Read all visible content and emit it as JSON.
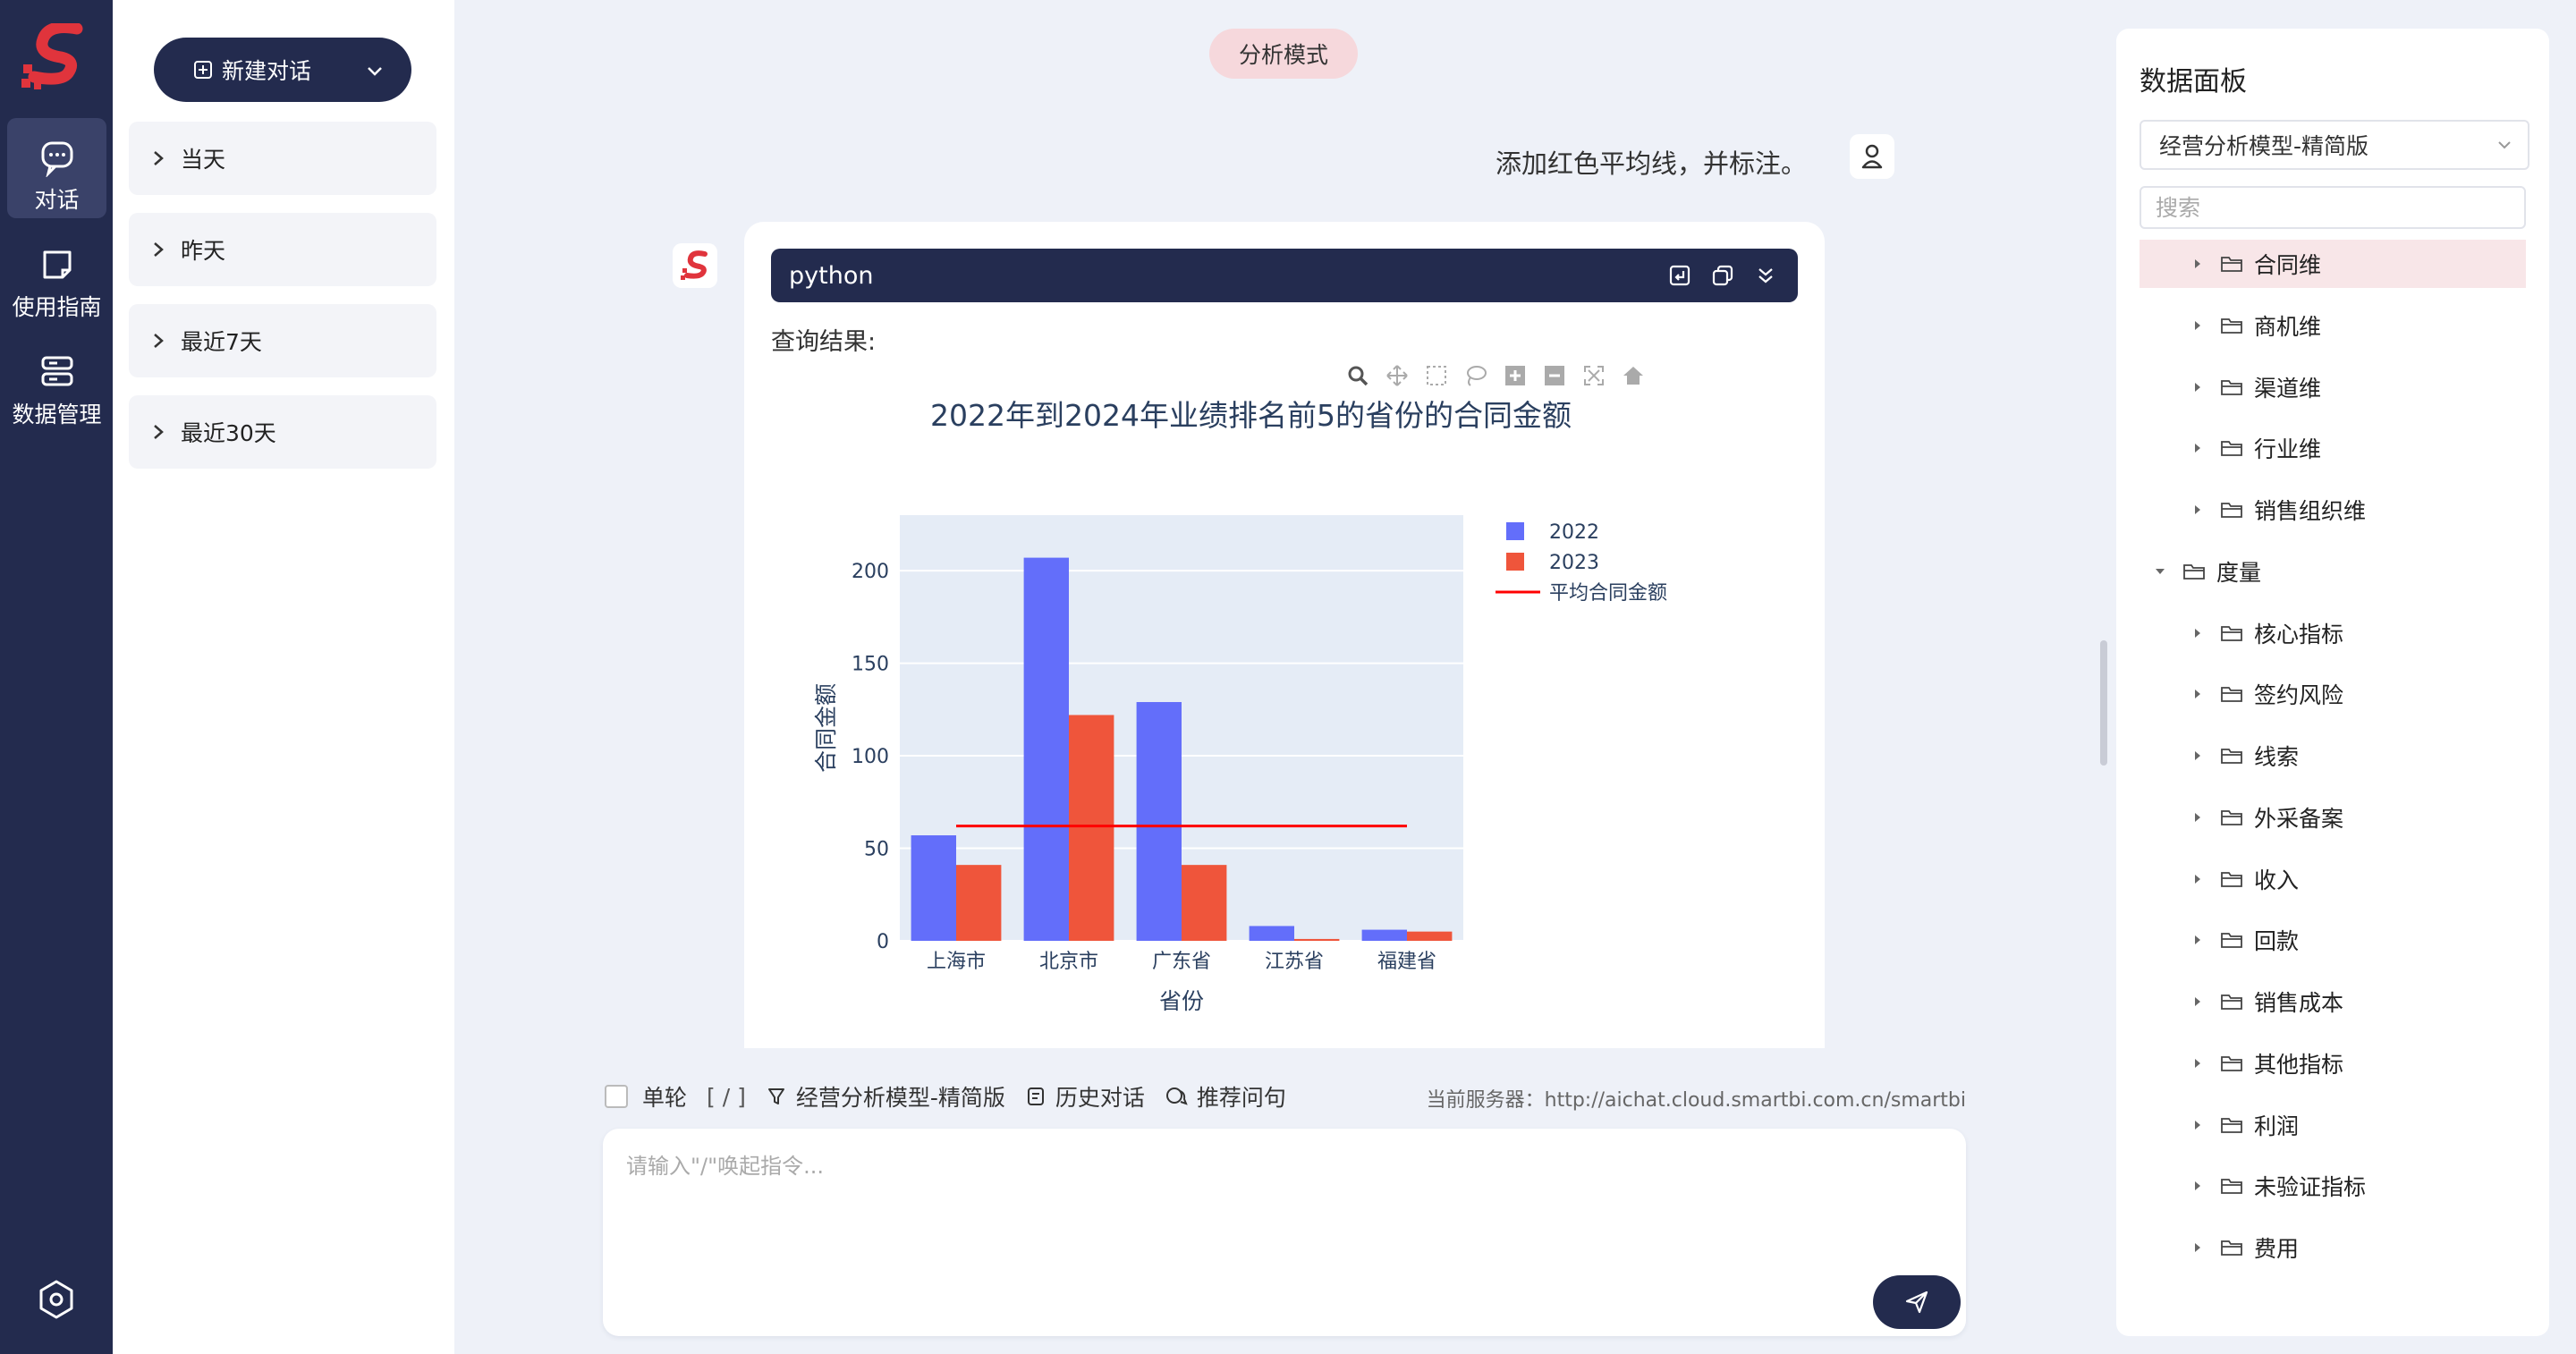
{
  "nav": {
    "items": [
      {
        "label": "对话",
        "icon": "chat-icon"
      },
      {
        "label": "使用指南",
        "icon": "guide-icon"
      },
      {
        "label": "数据管理",
        "icon": "database-icon"
      }
    ],
    "settings_icon": "settings-icon"
  },
  "history": {
    "new_chat_label": "新建对话",
    "groups": [
      "当天",
      "昨天",
      "最近7天",
      "最近30天"
    ]
  },
  "main": {
    "mode_label": "分析模式",
    "user_message": "添加红色平均线，并标注。",
    "code_language": "python",
    "result_label": "查询结果:"
  },
  "chart_data": {
    "type": "bar",
    "title": "2022年到2024年业绩排名前5的省份的合同金额",
    "xlabel": "省份",
    "ylabel": "合同金额",
    "categories": [
      "上海市",
      "北京市",
      "广东省",
      "江苏省",
      "福建省"
    ],
    "series": [
      {
        "name": "2022",
        "values": [
          57,
          207,
          129,
          8,
          6
        ],
        "color": "#636efa"
      },
      {
        "name": "2023",
        "values": [
          41,
          122,
          41,
          1,
          5
        ],
        "color": "#ef553b"
      }
    ],
    "average_line": {
      "name": "平均合同金额",
      "value": 62,
      "color": "#ff0000"
    },
    "ylim": [
      0,
      230
    ],
    "yticks": [
      0,
      50,
      100,
      150,
      200
    ],
    "legend_position": "top-right",
    "grid": true,
    "plot_bg": "#e5ecf6"
  },
  "input": {
    "single_round_label": "单轮",
    "command_hint": "[ / ]",
    "model_label": "经营分析模型-精简版",
    "history_label": "历史对话",
    "recommend_label": "推荐问句",
    "server_text": "当前服务器：http://aichat.cloud.smartbi.com.cn/smartbi",
    "placeholder": "请输入\"/\"唤起指令..."
  },
  "panel": {
    "title": "数据面板",
    "selected_model": "经营分析模型-精简版",
    "search_placeholder": "搜索",
    "tree": [
      {
        "label": "合同维",
        "level": 1,
        "expanded": false,
        "selected": true
      },
      {
        "label": "商机维",
        "level": 1,
        "expanded": false
      },
      {
        "label": "渠道维",
        "level": 1,
        "expanded": false
      },
      {
        "label": "行业维",
        "level": 1,
        "expanded": false
      },
      {
        "label": "销售组织维",
        "level": 1,
        "expanded": false
      },
      {
        "label": "度量",
        "level": 0,
        "expanded": true
      },
      {
        "label": "核心指标",
        "level": 1,
        "expanded": false
      },
      {
        "label": "签约风险",
        "level": 1,
        "expanded": false
      },
      {
        "label": "线索",
        "level": 1,
        "expanded": false
      },
      {
        "label": "外采备案",
        "level": 1,
        "expanded": false
      },
      {
        "label": "收入",
        "level": 1,
        "expanded": false
      },
      {
        "label": "回款",
        "level": 1,
        "expanded": false
      },
      {
        "label": "销售成本",
        "level": 1,
        "expanded": false
      },
      {
        "label": "其他指标",
        "level": 1,
        "expanded": false
      },
      {
        "label": "利润",
        "level": 1,
        "expanded": false
      },
      {
        "label": "未验证指标",
        "level": 1,
        "expanded": false
      },
      {
        "label": "费用",
        "level": 1,
        "expanded": false
      }
    ]
  },
  "colors": {
    "nav_bg": "#232b4e",
    "accent": "#e0343c",
    "pill_bg": "#f6d8dc"
  }
}
